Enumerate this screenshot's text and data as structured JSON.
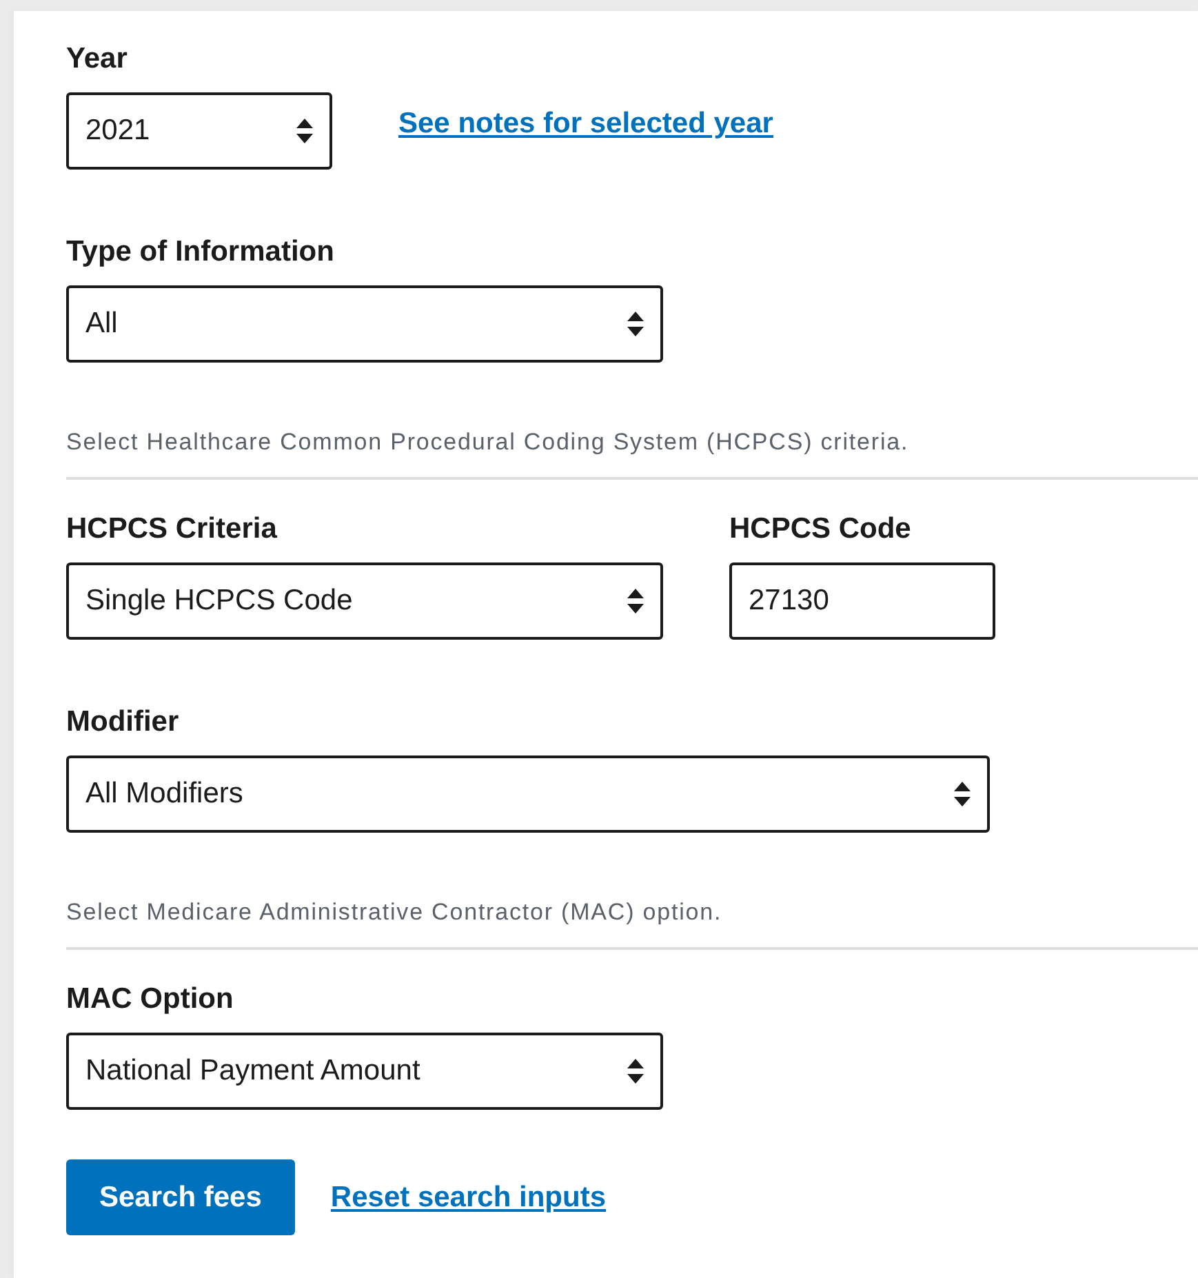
{
  "rows": [
    {
      "kind": "fields",
      "items": [
        {
          "kind": "select",
          "label": "Year",
          "value": "2021"
        },
        {
          "kind": "link",
          "text": "See notes for selected year"
        }
      ]
    },
    {
      "kind": "fields",
      "items": [
        {
          "kind": "select",
          "label": "Type of Information",
          "value": "All"
        }
      ]
    },
    {
      "kind": "note",
      "text": "Select Healthcare Common Procedural Coding System (HCPCS) criteria."
    },
    {
      "kind": "fields",
      "items": [
        {
          "kind": "select",
          "label": "HCPCS Criteria",
          "value": "Single HCPCS Code"
        },
        {
          "kind": "text",
          "label": "HCPCS Code",
          "value": "27130"
        }
      ]
    },
    {
      "kind": "fields",
      "items": [
        {
          "kind": "select",
          "label": "Modifier",
          "value": "All Modifiers"
        }
      ]
    },
    {
      "kind": "note",
      "text": "Select Medicare Administrative Contractor (MAC) option."
    },
    {
      "kind": "fields",
      "items": [
        {
          "kind": "select",
          "label": "MAC Option",
          "value": "National Payment Amount"
        }
      ]
    },
    {
      "kind": "actions",
      "button": "Search fees",
      "link": "Reset search inputs"
    }
  ]
}
